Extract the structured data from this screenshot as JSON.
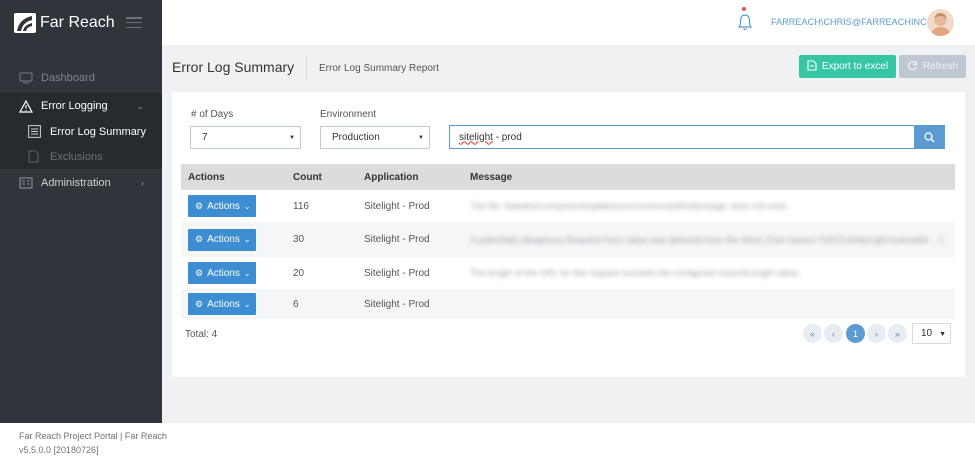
{
  "brand": {
    "name": "Far Reach"
  },
  "sidebar": {
    "items": [
      {
        "label": "Dashboard",
        "icon": "dashboard-icon"
      },
      {
        "label": "Error Logging",
        "icon": "warning-icon"
      },
      {
        "label": "Administration",
        "icon": "admin-icon"
      }
    ],
    "sub_items": [
      {
        "label": "Error Log Summary",
        "icon": "list-icon"
      },
      {
        "label": "Exclusions",
        "icon": "document-icon"
      }
    ]
  },
  "topbar": {
    "username": "FARREACH\\CHRIS@FARREACHINC.COM"
  },
  "page": {
    "title": "Error Log Summary",
    "subtitle": "Error Log Summary Report",
    "export_label": "Export to excel",
    "refresh_label": "Refresh"
  },
  "filters": {
    "days_label": "# of Days",
    "days_value": "7",
    "env_label": "Environment",
    "env_value": "Production",
    "search_word": "sitelight",
    "search_rest": " - prod"
  },
  "table": {
    "columns": [
      "Actions",
      "Count",
      "Application",
      "Message"
    ],
    "action_label": "Actions",
    "rows": [
      {
        "count": "116",
        "application": "Sitelight - Prod",
        "message": "The file '/bawebs/components/gallery/un/common/ytl/folder/page' does not exist."
      },
      {
        "count": "30",
        "application": "Sitelight - Prod",
        "message": "A potentially dangerous Request.Form value was detected from the client (Trek values='%5T2-dotted.gbl-Insertable ...')."
      },
      {
        "count": "20",
        "application": "Sitelight - Prod",
        "message": "The length of the URL for this request exceeds the configured maxUrlLength value."
      },
      {
        "count": "6",
        "application": "Sitelight - Prod",
        "message": ""
      }
    ]
  },
  "pagination": {
    "total_text": "Total: 4",
    "first": "«",
    "prev": "‹",
    "current": "1",
    "next": "›",
    "last": "»",
    "page_size": "10"
  },
  "footer": {
    "line1": "Far Reach Project Portal | Far Reach",
    "line2": "v5.5.0.0 [20180726]"
  },
  "colors": {
    "sidebar": "#2f353b",
    "accent_blue": "#5b9bd1",
    "export_green": "#36c6a3",
    "action_blue": "#3c8dd1"
  }
}
